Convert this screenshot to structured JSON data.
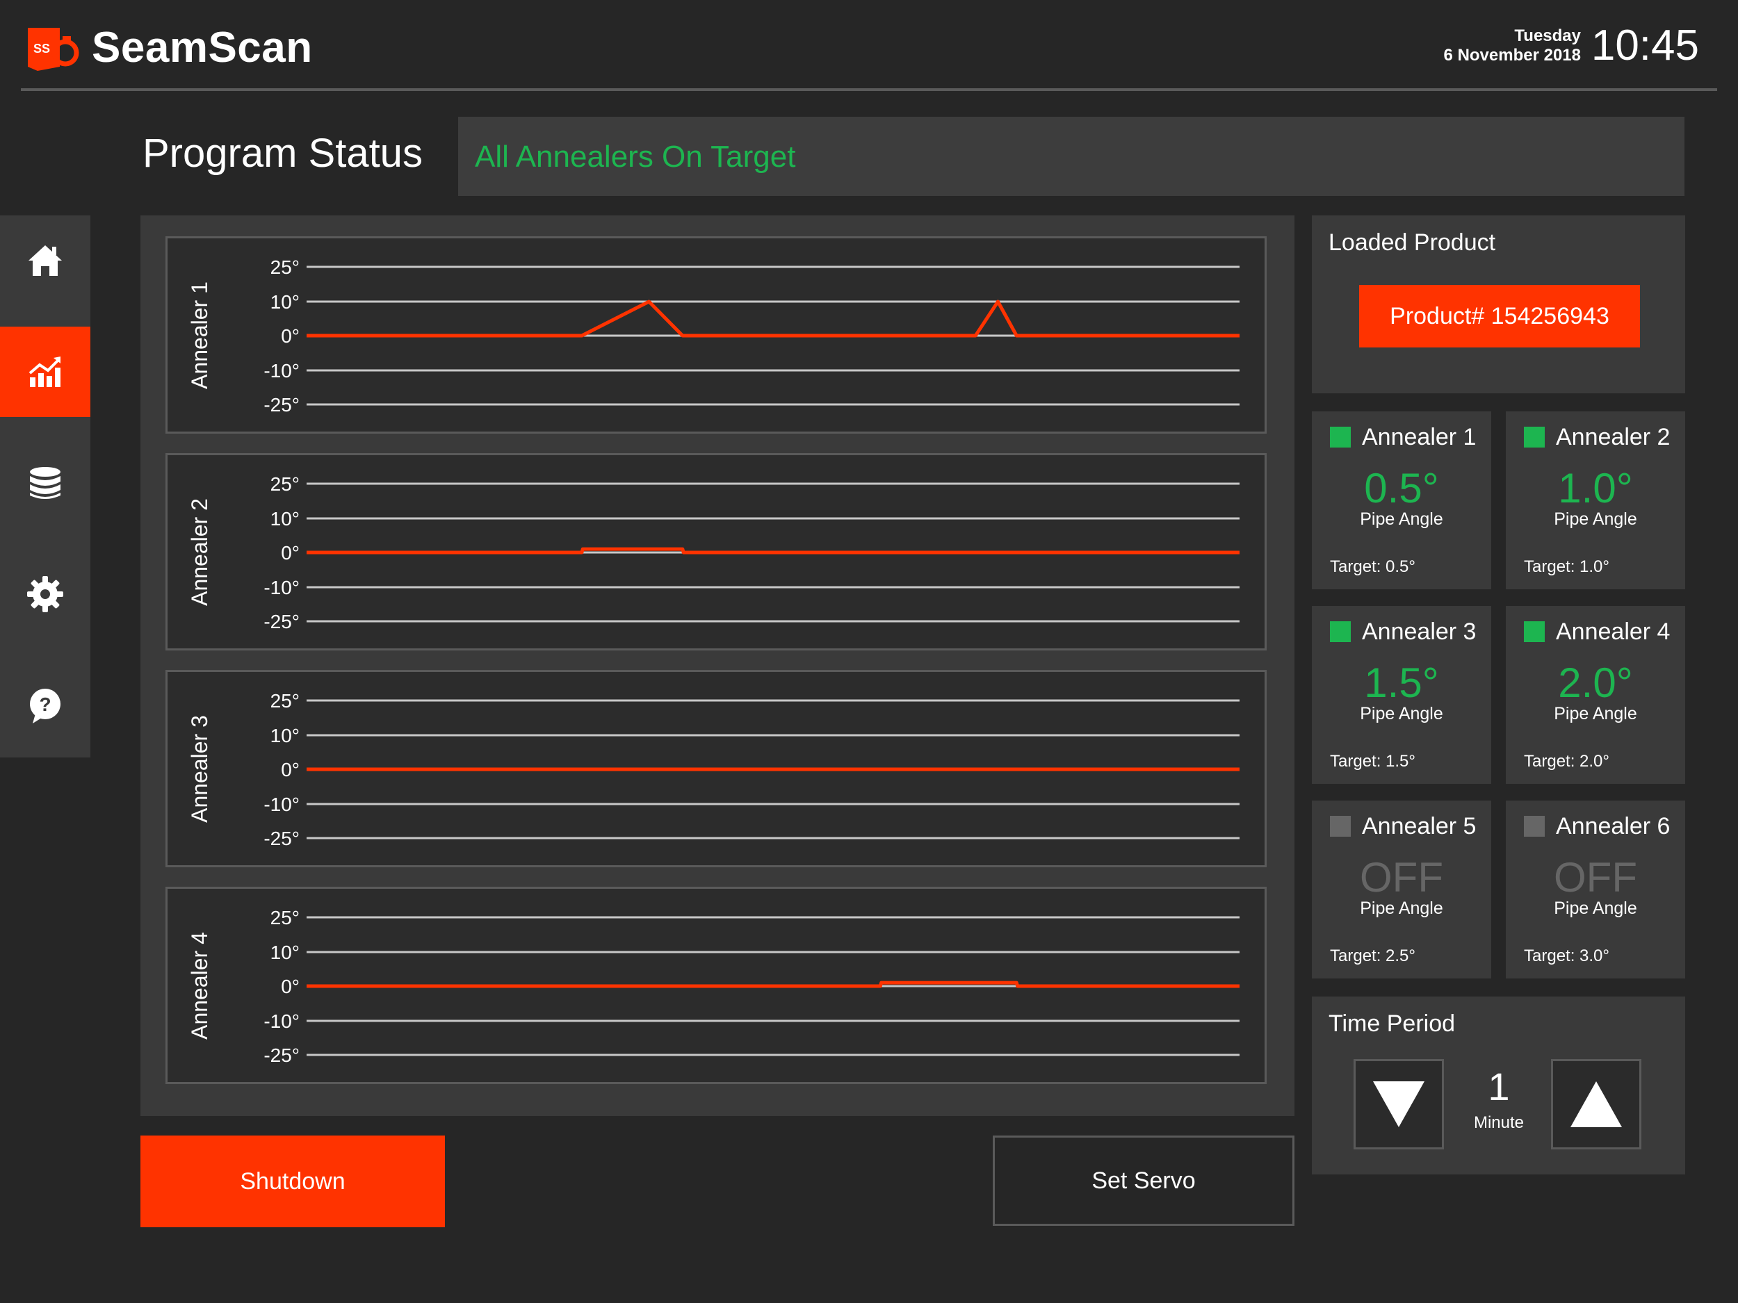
{
  "header": {
    "app_title": "SeamScan",
    "logo_text": "SS",
    "day": "Tuesday",
    "date": "6 November 2018",
    "time": "10:45"
  },
  "status": {
    "title": "Program Status",
    "message": "All Annealers On Target"
  },
  "sidebar": {
    "items": [
      {
        "icon": "home-icon",
        "active": false
      },
      {
        "icon": "chart-icon",
        "active": true
      },
      {
        "icon": "database-icon",
        "active": false
      },
      {
        "icon": "gear-icon",
        "active": false
      },
      {
        "icon": "help-icon",
        "active": false
      }
    ]
  },
  "colors": {
    "accent": "#ff3300",
    "on_target": "#1db550",
    "off": "#666666"
  },
  "chart_data": [
    {
      "type": "line",
      "title": "Annealer 1",
      "y_ticks": [
        "25°",
        "10°",
        "0°",
        "-10°",
        "-25°"
      ],
      "ylim": [
        -25,
        25
      ],
      "x": [
        0,
        0.295,
        0.367,
        0.403,
        0.717,
        0.741,
        0.761,
        1
      ],
      "values": [
        0,
        0,
        10,
        0,
        0,
        10,
        0,
        0
      ]
    },
    {
      "type": "line",
      "title": "Annealer 2",
      "y_ticks": [
        "25°",
        "10°",
        "0°",
        "-10°",
        "-25°"
      ],
      "ylim": [
        -25,
        25
      ],
      "x": [
        0,
        0.295,
        0.296,
        0.403,
        0.404,
        1
      ],
      "values": [
        0,
        0,
        1,
        1,
        0,
        0
      ]
    },
    {
      "type": "line",
      "title": "Annealer 3",
      "y_ticks": [
        "25°",
        "10°",
        "0°",
        "-10°",
        "-25°"
      ],
      "ylim": [
        -25,
        25
      ],
      "x": [
        0,
        1
      ],
      "values": [
        0,
        0
      ]
    },
    {
      "type": "line",
      "title": "Annealer 4",
      "y_ticks": [
        "25°",
        "10°",
        "0°",
        "-10°",
        "-25°"
      ],
      "ylim": [
        -25,
        25
      ],
      "x": [
        0,
        0.615,
        0.616,
        0.761,
        0.762,
        1
      ],
      "values": [
        0,
        0,
        1,
        1,
        0,
        0
      ]
    }
  ],
  "loaded_product": {
    "title": "Loaded Product",
    "product_label": "Product# 154256943"
  },
  "annealers": [
    {
      "name": "Annealer 1",
      "value": "0.5°",
      "sub": "Pipe Angle",
      "target": "Target: 0.5°",
      "on": true
    },
    {
      "name": "Annealer 2",
      "value": "1.0°",
      "sub": "Pipe Angle",
      "target": "Target: 1.0°",
      "on": true
    },
    {
      "name": "Annealer 3",
      "value": "1.5°",
      "sub": "Pipe Angle",
      "target": "Target: 1.5°",
      "on": true
    },
    {
      "name": "Annealer 4",
      "value": "2.0°",
      "sub": "Pipe Angle",
      "target": "Target: 2.0°",
      "on": true
    },
    {
      "name": "Annealer 5",
      "value": "OFF",
      "sub": "Pipe Angle",
      "target": "Target: 2.5°",
      "on": false
    },
    {
      "name": "Annealer 6",
      "value": "OFF",
      "sub": "Pipe Angle",
      "target": "Target: 3.0°",
      "on": false
    }
  ],
  "time_period": {
    "title": "Time Period",
    "value": "1",
    "unit": "Minute"
  },
  "buttons": {
    "shutdown": "Shutdown",
    "set_servo": "Set Servo"
  }
}
